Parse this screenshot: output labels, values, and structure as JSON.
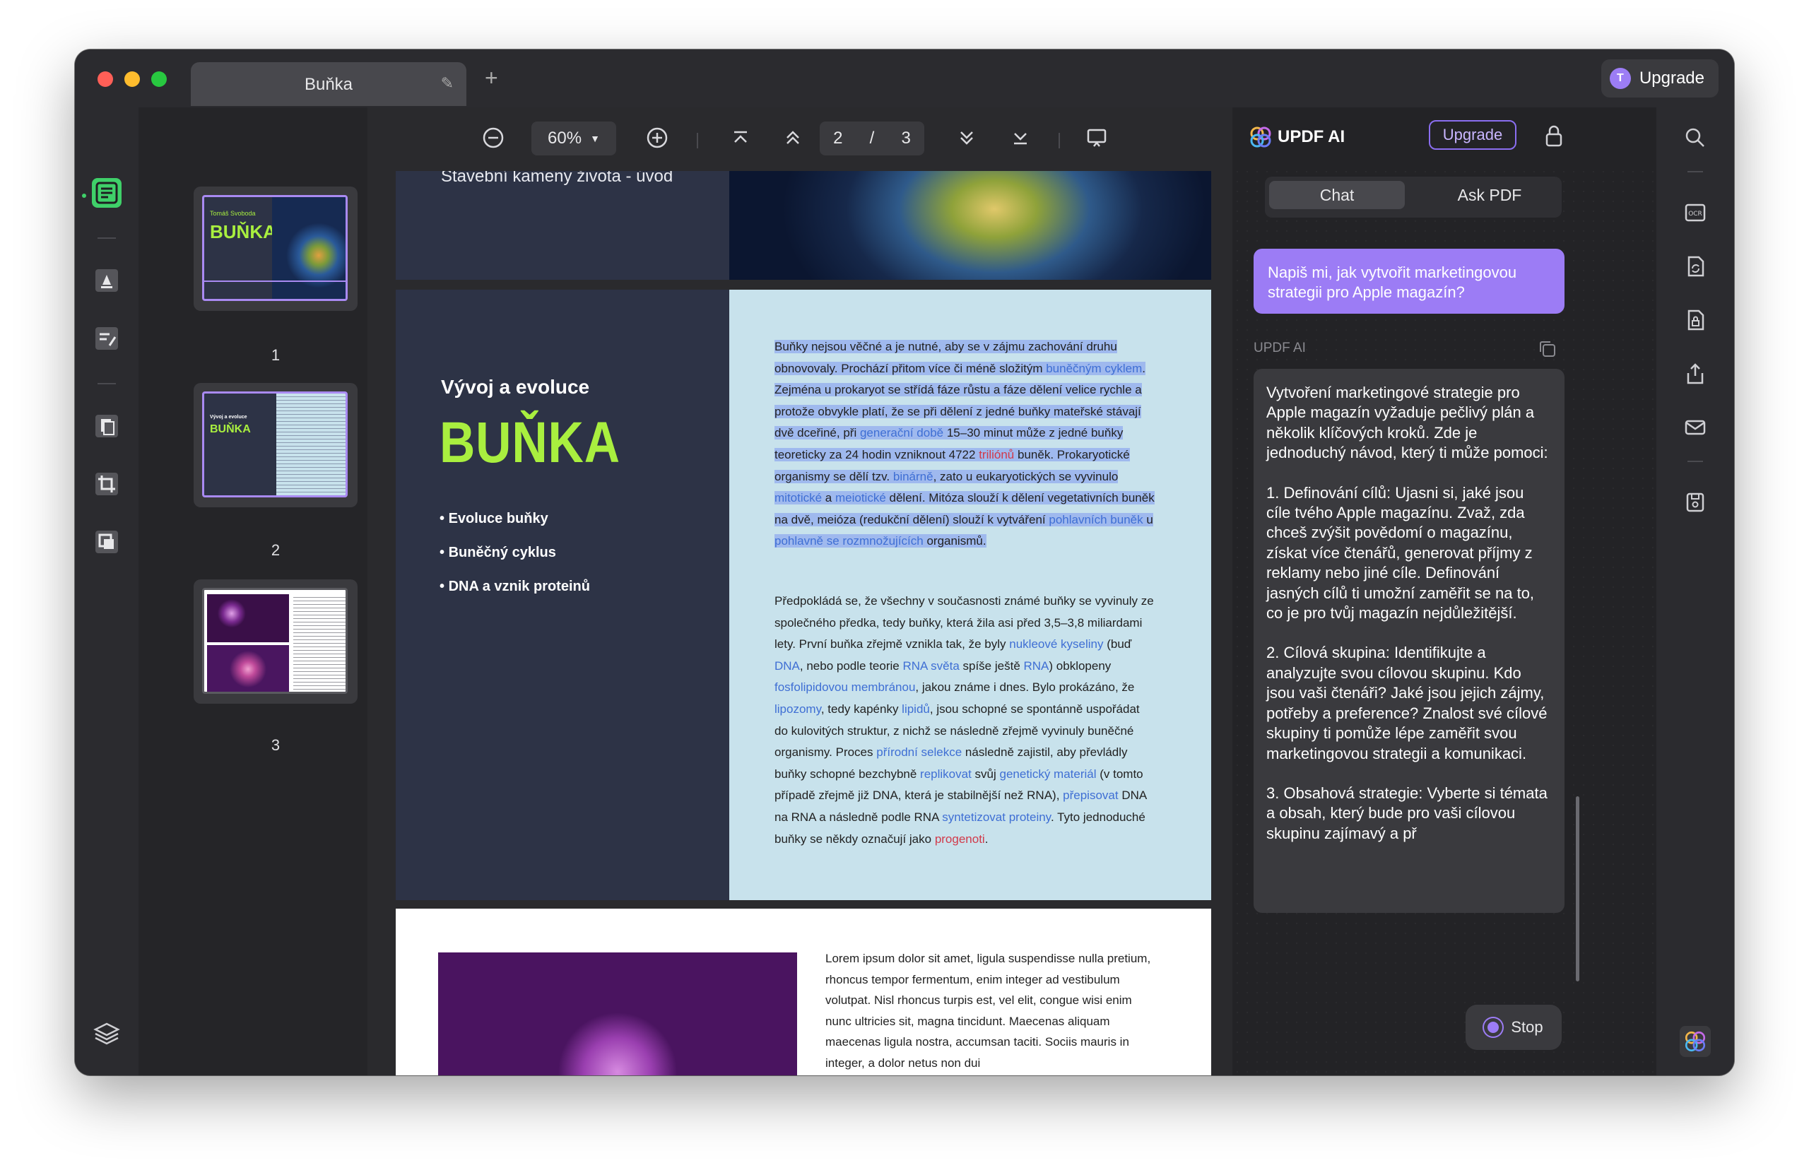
{
  "window": {
    "tab_title": "Buňka",
    "upgrade_label": "Upgrade",
    "avatar_letter": "T"
  },
  "toolbar": {
    "zoom": "60%",
    "current_page": "2",
    "page_separator": "/",
    "total_pages": "3"
  },
  "thumbnails": [
    {
      "number": "1",
      "title": "BUŇKA",
      "subtitle": "Tomáš Svoboda"
    },
    {
      "number": "2",
      "title": "BUŇKA",
      "subtitle": "Vývoj a evoluce"
    },
    {
      "number": "3"
    }
  ],
  "page1": {
    "subtitle": "Stavební kameny života - úvod"
  },
  "page2": {
    "heading": "Vývoj a evoluce",
    "title": "BUŇKA",
    "bullets": [
      "Evoluce buňky",
      "Buněčný cyklus",
      "DNA a vznik proteinů"
    ],
    "para1_segments": [
      {
        "t": "Buňky nejsou věčné a je nutné, aby se v zájmu zachování druhu obnovovaly. Prochází přitom více či méně složitým ",
        "c": ""
      },
      {
        "t": "buněčným cyklem",
        "c": "lk"
      },
      {
        "t": ". Zejména u prokaryot se střídá fáze růstu a fáze dělení velice rychle a protože obvykle platí, že se při dělení z jedné buňky mateřské stávají dvě dceřiné, při ",
        "c": ""
      },
      {
        "t": "generační době",
        "c": "lk"
      },
      {
        "t": " 15–30 minut může z jedné buňky teoreticky za 24 hodin vzniknout 4722 ",
        "c": ""
      },
      {
        "t": "triliónů",
        "c": "lk-red"
      },
      {
        "t": " buněk. Prokaryotické organismy se dělí tzv. ",
        "c": ""
      },
      {
        "t": "binárně",
        "c": "lk"
      },
      {
        "t": ", zato u eukaryotických se vyvinulo ",
        "c": ""
      },
      {
        "t": "mitotické",
        "c": "lk"
      },
      {
        "t": " a ",
        "c": ""
      },
      {
        "t": "meiotické",
        "c": "lk"
      },
      {
        "t": " dělení. Mitóza slouží k dělení vegetativních buněk na dvě, meióza (redukční dělení) slouží k vytváření ",
        "c": ""
      },
      {
        "t": "pohlavních buněk",
        "c": "lk"
      },
      {
        "t": " u ",
        "c": ""
      },
      {
        "t": "pohlavně se rozmnožujících",
        "c": "lk"
      },
      {
        "t": " organismů.",
        "c": ""
      }
    ],
    "para2_segments": [
      {
        "t": "Předpokládá se, že všechny v současnosti známé buňky se vyvinuly ze společného předka, tedy buňky, která žila asi před 3,5–3,8 miliardami lety. První buňka zřejmě vznikla tak, že byly ",
        "c": ""
      },
      {
        "t": "nukleové kyseliny",
        "c": "lk"
      },
      {
        "t": " (buď ",
        "c": ""
      },
      {
        "t": "DNA",
        "c": "lk"
      },
      {
        "t": ", nebo podle teorie ",
        "c": ""
      },
      {
        "t": "RNA světa",
        "c": "lk"
      },
      {
        "t": " spíše ještě ",
        "c": ""
      },
      {
        "t": "RNA",
        "c": "lk"
      },
      {
        "t": ") obklopeny ",
        "c": ""
      },
      {
        "t": "fosfolipidovou membránou",
        "c": "lk"
      },
      {
        "t": ", jakou známe i dnes. Bylo prokázáno, že ",
        "c": ""
      },
      {
        "t": "lipozomy",
        "c": "lk"
      },
      {
        "t": ", tedy kapénky ",
        "c": ""
      },
      {
        "t": "lipidů",
        "c": "lk"
      },
      {
        "t": ", jsou schopné se spontánně uspořádat do kulovitých struktur, z nichž se následně zřejmě vyvinuly buněčné organismy. Proces ",
        "c": ""
      },
      {
        "t": "přírodní selekce",
        "c": "lk"
      },
      {
        "t": " následně zajistil, aby převládly buňky schopné bezchybně ",
        "c": ""
      },
      {
        "t": "replikovat",
        "c": "lk"
      },
      {
        "t": " svůj ",
        "c": ""
      },
      {
        "t": "genetický materiál",
        "c": "lk"
      },
      {
        "t": " (v tomto případě zřejmě již DNA, která je stabilnější než RNA), ",
        "c": ""
      },
      {
        "t": "přepisovat",
        "c": "lk"
      },
      {
        "t": " DNA na RNA a následně podle RNA ",
        "c": ""
      },
      {
        "t": "syntetizovat proteiny",
        "c": "lk"
      },
      {
        "t": ". Tyto jednoduché buňky se někdy označují jako ",
        "c": ""
      },
      {
        "t": "progenoti",
        "c": "lk-red"
      },
      {
        "t": ".",
        "c": ""
      }
    ]
  },
  "page3": {
    "text": "Lorem ipsum dolor sit amet, ligula suspendisse nulla pretium, rhoncus tempor fermentum, enim integer ad vestibulum volutpat. Nisl rhoncus turpis est, vel elit, congue wisi enim nunc ultricies sit, magna tincidunt. Maecenas aliquam maecenas ligula nostra, accumsan taciti. Sociis mauris in integer, a dolor netus non dui"
  },
  "ai": {
    "title": "UPDF AI",
    "upgrade_label": "Upgrade",
    "tabs": [
      "Chat",
      "Ask PDF"
    ],
    "user_message": "Napiš mi, jak vytvořit marketingovou strategii pro Apple magazín?",
    "response_label": "UPDF AI",
    "response_paragraphs": [
      "Vytvoření marketingové strategie pro Apple magazín vyžaduje pečlivý plán a několik klíčových kroků. Zde je jednoduchý návod, který ti může pomoci:",
      "1. Definování cílů: Ujasni si, jaké jsou cíle tvého Apple magazínu. Zvaž, zda chceš zvýšit povědomí o magazínu, získat více čtenářů, generovat příjmy z reklamy nebo jiné cíle. Definování jasných cílů ti umožní zaměřit se na to, co je pro tvůj magazín nejdůležitější.",
      "2. Cílová skupina: Identifikujte a analyzujte svou cílovou skupinu. Kdo jsou vaši čtenáři? Jaké jsou jejich zájmy, potřeby a preference? Znalost své cílové skupiny ti pomůže lépe zaměřit svou marketingovou strategii a komunikaci.",
      "3. Obsahová strategie: Vyberte si témata a obsah, který bude pro vaši cílovou skupinu zajímavý a př"
    ],
    "stop_label": "Stop"
  },
  "colors": {
    "accent": "#9c7cf5",
    "title_green": "#a9ef3f",
    "link_blue": "#3f6fd4",
    "selection": "#9fb9ee"
  }
}
